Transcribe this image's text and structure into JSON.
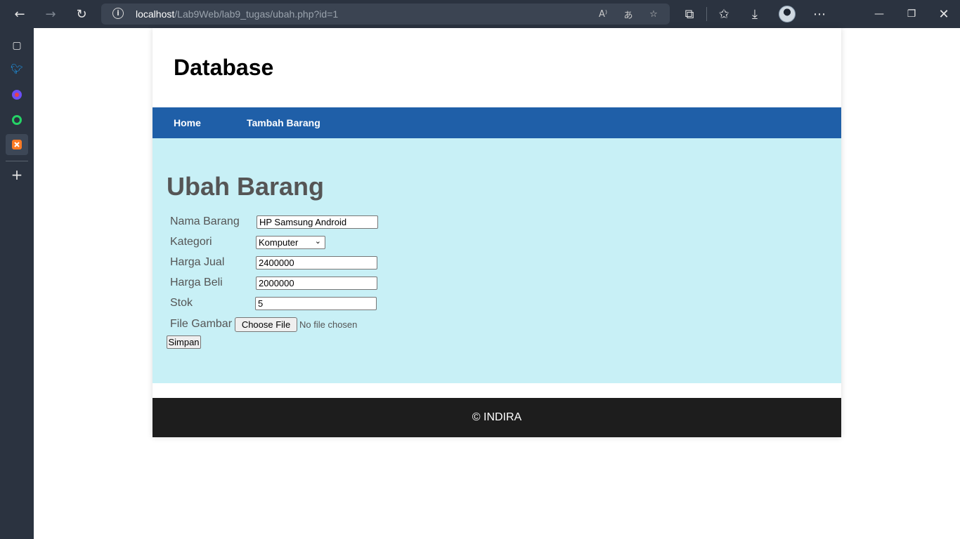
{
  "browser": {
    "url_host": "localhost",
    "url_path": "/Lab9Web/lab9_tugas/ubah.php?id=1"
  },
  "site": {
    "title": "Database",
    "nav": [
      "Home",
      "Tambah Barang"
    ],
    "footer": "© INDIRA"
  },
  "form": {
    "heading": "Ubah Barang",
    "labels": {
      "nama": "Nama Barang",
      "kategori": "Kategori",
      "harga_jual": "Harga Jual",
      "harga_beli": "Harga Beli",
      "stok": "Stok",
      "gambar": "File Gambar"
    },
    "values": {
      "nama": "HP Samsung Android",
      "kategori": "Komputer",
      "harga_jual": "2400000",
      "harga_beli": "2000000",
      "stok": "5"
    },
    "file_button": "Choose File",
    "file_status": "No file chosen",
    "submit": "Simpan"
  },
  "colors": {
    "nav_bg": "#1f5fa8",
    "content_bg": "#c8f0f6",
    "footer_bg": "#1d1d1d",
    "browser_chrome": "#2b3340"
  }
}
